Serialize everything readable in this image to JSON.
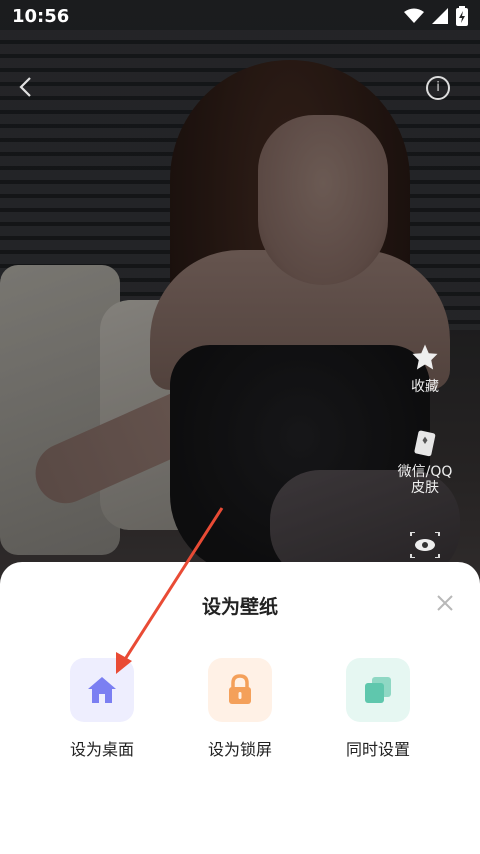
{
  "statusbar": {
    "time": "10:56"
  },
  "side_actions": [
    {
      "label": "收藏",
      "icon": "star-icon"
    },
    {
      "label": "微信/QQ\n皮肤",
      "icon": "skin-card-icon"
    },
    {
      "label": "",
      "icon": "preview-eye-icon"
    }
  ],
  "sheet": {
    "title": "设为壁纸",
    "options": [
      {
        "label": "设为桌面",
        "icon": "home-icon",
        "color": "#7b7ff2",
        "bg": "#eeeefe"
      },
      {
        "label": "设为锁屏",
        "icon": "lock-icon",
        "color": "#f4a05a",
        "bg": "#fff1e6"
      },
      {
        "label": "同时设置",
        "icon": "copy-icon",
        "color": "#5fc7ad",
        "bg": "#e6f7f2"
      }
    ]
  }
}
